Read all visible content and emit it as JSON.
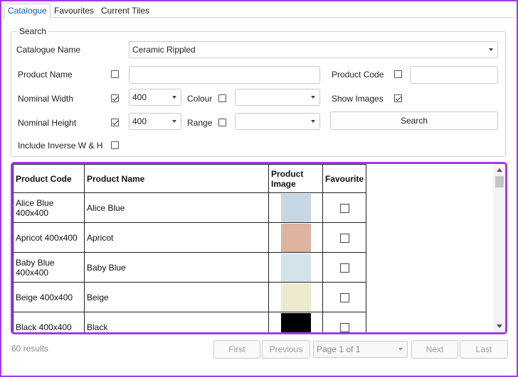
{
  "tabs": [
    {
      "label": "Catalogue"
    },
    {
      "label": "Favourites"
    },
    {
      "label": "Current Tiles"
    }
  ],
  "search": {
    "group_title": "Search",
    "catalogue_name_label": "Catalogue Name",
    "catalogue_name_value": "Ceramic Rippled",
    "product_name_label": "Product Name",
    "product_name_value": "",
    "product_code_label": "Product Code",
    "product_code_value": "",
    "nominal_width_label": "Nominal Width",
    "nominal_width_value": "400",
    "nominal_height_label": "Nominal Height",
    "nominal_height_value": "400",
    "colour_label": "Colour",
    "colour_value": "",
    "range_label": "Range",
    "range_value": "",
    "show_images_label": "Show Images",
    "include_inverse_label": "Include Inverse W & H",
    "search_button": "Search",
    "checks": {
      "product_name": false,
      "product_code": false,
      "nominal_width": true,
      "nominal_height": true,
      "colour": false,
      "range": false,
      "show_images": true,
      "include_inverse": false
    }
  },
  "grid": {
    "columns": [
      "Product Code",
      "Product Name",
      "Product\nImage",
      "Favourite"
    ],
    "rows": [
      {
        "code": "Alice Blue\n400x400",
        "name": "Alice Blue",
        "color": "#c8d7e6",
        "favourite": false
      },
      {
        "code": "Apricot 400x400",
        "name": "Apricot",
        "color": "#dcb4a0",
        "favourite": false
      },
      {
        "code": "Baby Blue\n400x400",
        "name": "Baby Blue",
        "color": "#d2e4ea",
        "favourite": false
      },
      {
        "code": "Beige 400x400",
        "name": "Beige",
        "color": "#ecebce",
        "favourite": false
      },
      {
        "code": "Black 400x400",
        "name": "Black",
        "color": "#000000",
        "favourite": false
      }
    ]
  },
  "footer": {
    "results": "60 results",
    "first": "First",
    "previous": "Previous",
    "page": "Page 1 of 1",
    "next": "Next",
    "last": "Last"
  }
}
